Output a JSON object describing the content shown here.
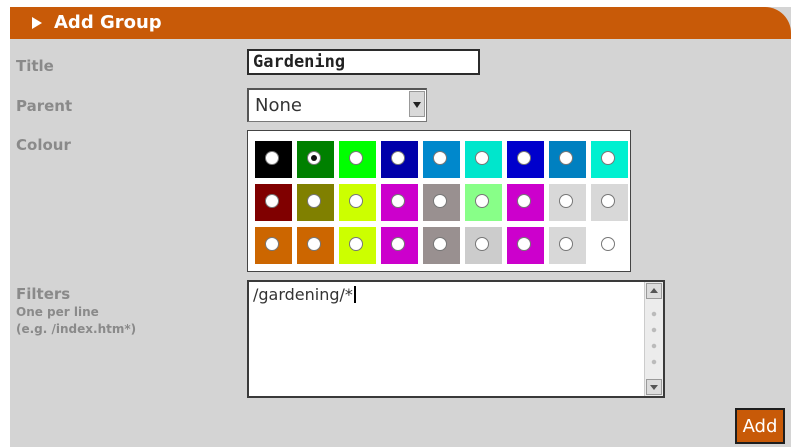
{
  "form": {
    "header_title": "Add Group",
    "title_label": "Title",
    "title_value": "Gardening",
    "parent_label": "Parent",
    "parent_selected": "None",
    "colour_label": "Colour",
    "filters_label": "Filters",
    "filters_hint_1": "One per line",
    "filters_hint_2": "(e.g. /index.htm*)",
    "filters_value": "/gardening/*",
    "add_label": "Add"
  },
  "colours": [
    "#000000",
    "#008000",
    "#00ff00",
    "#0000aa",
    "#0088cc",
    "#00e6cc",
    "#0000cc",
    "#0080c0",
    "#00f0d0",
    "#800000",
    "#808000",
    "#ccff00",
    "#cc00cc",
    "#999090",
    "#88ff88",
    "#cc00cc",
    "#d8d8d8",
    "#d8d8d8",
    "#cc6600",
    "#cc6600",
    "#ccff00",
    "#cc00cc",
    "#999090",
    "#cccccc",
    "#cc00cc",
    "#d8d8d8",
    "#ffffff"
  ],
  "selected_colour_index": 1,
  "theme": {
    "accent": "#c85a08",
    "panel": "#d4d4d4",
    "label": "#8a8a8a"
  }
}
